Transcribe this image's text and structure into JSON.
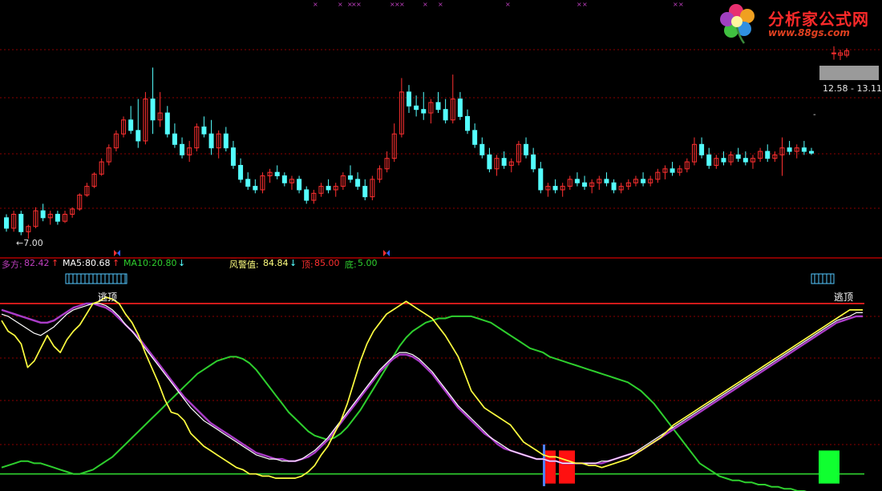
{
  "logo": {
    "title": "分析家公式网",
    "url": "www.88gs.com"
  },
  "price_panel": {
    "low_label": "←7.00",
    "range_label": "12.58 - 13.11"
  },
  "indicator_header": {
    "duofang_label": "多方:",
    "duofang_value": "82.42",
    "duofang_arrow": "↑",
    "ma5_label": "MA5:",
    "ma5_value": "80.68",
    "ma5_arrow": "↑",
    "ma10_label": "MA10:",
    "ma10_value": "20.80",
    "ma10_arrow": "↓",
    "warn_label": "风警值:",
    "warn_value": "84.84",
    "warn_arrow": "↓",
    "top_label": "顶:",
    "top_value": "85.00",
    "bottom_label": "底:",
    "bottom_value": "5.00"
  },
  "signals": {
    "escape_top_1": "逃顶",
    "escape_top_2": "逃顶"
  },
  "colors": {
    "up": "#ff3030",
    "down": "#54ffff",
    "grid": "#8b0000",
    "duofang": "#ffff40",
    "ma5": "#ffffff",
    "ma10": "#aa3cc8",
    "warn": "#2ecf2e",
    "top_line": "#ff2020",
    "bottom_line": "#2ecf2e",
    "marker": "#c040c0"
  },
  "chart_data": [
    {
      "type": "candlestick",
      "title": "",
      "xlabel": "",
      "ylabel": "",
      "candles": [
        [
          7.6,
          7.7,
          7.2,
          7.3
        ],
        [
          7.3,
          7.8,
          7.2,
          7.7
        ],
        [
          7.7,
          7.8,
          7.1,
          7.2
        ],
        [
          7.2,
          7.4,
          7.0,
          7.35
        ],
        [
          7.35,
          7.9,
          7.3,
          7.8
        ],
        [
          7.8,
          8.0,
          7.5,
          7.6
        ],
        [
          7.6,
          7.8,
          7.4,
          7.7
        ],
        [
          7.7,
          7.8,
          7.4,
          7.5
        ],
        [
          7.5,
          7.8,
          7.45,
          7.7
        ],
        [
          7.7,
          7.9,
          7.6,
          7.85
        ],
        [
          7.85,
          8.3,
          7.8,
          8.25
        ],
        [
          8.25,
          8.6,
          8.2,
          8.5
        ],
        [
          8.5,
          8.9,
          8.45,
          8.85
        ],
        [
          8.85,
          9.3,
          8.8,
          9.2
        ],
        [
          9.2,
          9.7,
          9.1,
          9.6
        ],
        [
          9.6,
          10.1,
          9.5,
          10.0
        ],
        [
          10.0,
          10.5,
          9.9,
          10.4
        ],
        [
          10.4,
          10.8,
          10.0,
          10.1
        ],
        [
          10.1,
          11.0,
          9.6,
          9.8
        ],
        [
          9.8,
          11.2,
          9.7,
          11.0
        ],
        [
          11.0,
          11.9,
          10.0,
          10.4
        ],
        [
          10.4,
          11.2,
          10.2,
          10.6
        ],
        [
          10.6,
          10.8,
          9.9,
          10.0
        ],
        [
          10.0,
          10.3,
          9.6,
          9.7
        ],
        [
          9.7,
          9.9,
          9.3,
          9.4
        ],
        [
          9.4,
          9.8,
          9.2,
          9.6
        ],
        [
          9.6,
          10.3,
          9.5,
          10.2
        ],
        [
          10.2,
          10.5,
          9.9,
          10.0
        ],
        [
          10.0,
          10.4,
          9.4,
          9.6
        ],
        [
          9.6,
          10.1,
          9.3,
          10.0
        ],
        [
          10.0,
          10.2,
          9.5,
          9.6
        ],
        [
          9.6,
          9.8,
          9.0,
          9.1
        ],
        [
          9.1,
          9.3,
          8.6,
          8.7
        ],
        [
          8.7,
          8.9,
          8.4,
          8.5
        ],
        [
          8.5,
          8.7,
          8.3,
          8.4
        ],
        [
          8.4,
          8.9,
          8.3,
          8.8
        ],
        [
          8.8,
          9.0,
          8.6,
          8.9
        ],
        [
          8.9,
          9.1,
          8.7,
          8.8
        ],
        [
          8.8,
          8.9,
          8.5,
          8.6
        ],
        [
          8.6,
          8.8,
          8.4,
          8.7
        ],
        [
          8.7,
          8.8,
          8.3,
          8.4
        ],
        [
          8.4,
          8.5,
          8.0,
          8.1
        ],
        [
          8.1,
          8.4,
          8.0,
          8.3
        ],
        [
          8.3,
          8.6,
          8.2,
          8.5
        ],
        [
          8.5,
          8.7,
          8.3,
          8.4
        ],
        [
          8.4,
          8.6,
          8.2,
          8.5
        ],
        [
          8.5,
          8.9,
          8.4,
          8.8
        ],
        [
          8.8,
          9.1,
          8.6,
          8.7
        ],
        [
          8.7,
          8.9,
          8.4,
          8.5
        ],
        [
          8.5,
          8.7,
          8.1,
          8.2
        ],
        [
          8.2,
          8.8,
          8.1,
          8.7
        ],
        [
          8.7,
          9.1,
          8.6,
          9.0
        ],
        [
          9.0,
          9.5,
          8.9,
          9.3
        ],
        [
          9.3,
          10.3,
          9.2,
          10.0
        ],
        [
          10.0,
          11.6,
          9.9,
          11.2
        ],
        [
          11.2,
          11.4,
          10.6,
          10.8
        ],
        [
          10.8,
          11.1,
          10.5,
          10.7
        ],
        [
          10.7,
          11.2,
          10.4,
          10.6
        ],
        [
          10.6,
          11.0,
          10.3,
          10.9
        ],
        [
          10.9,
          11.2,
          10.6,
          10.7
        ],
        [
          10.7,
          11.0,
          10.3,
          10.4
        ],
        [
          10.4,
          11.7,
          10.3,
          11.0
        ],
        [
          11.0,
          11.2,
          10.4,
          10.5
        ],
        [
          10.5,
          10.7,
          10.0,
          10.1
        ],
        [
          10.1,
          10.3,
          9.6,
          9.7
        ],
        [
          9.7,
          9.9,
          9.3,
          9.4
        ],
        [
          9.4,
          9.6,
          8.9,
          9.0
        ],
        [
          9.0,
          9.4,
          8.8,
          9.3
        ],
        [
          9.3,
          9.5,
          9.0,
          9.1
        ],
        [
          9.1,
          9.3,
          8.9,
          9.2
        ],
        [
          9.2,
          9.8,
          9.1,
          9.7
        ],
        [
          9.7,
          9.9,
          9.3,
          9.4
        ],
        [
          9.4,
          9.6,
          8.9,
          9.0
        ],
        [
          9.0,
          9.2,
          8.3,
          8.4
        ],
        [
          8.4,
          8.6,
          8.2,
          8.5
        ],
        [
          8.5,
          8.7,
          8.3,
          8.4
        ],
        [
          8.4,
          8.6,
          8.2,
          8.5
        ],
        [
          8.5,
          8.8,
          8.4,
          8.7
        ],
        [
          8.7,
          8.9,
          8.5,
          8.6
        ],
        [
          8.6,
          8.8,
          8.4,
          8.5
        ],
        [
          8.5,
          8.7,
          8.3,
          8.6
        ],
        [
          8.6,
          8.8,
          8.4,
          8.7
        ],
        [
          8.7,
          8.9,
          8.5,
          8.6
        ],
        [
          8.6,
          8.7,
          8.3,
          8.4
        ],
        [
          8.4,
          8.6,
          8.3,
          8.5
        ],
        [
          8.5,
          8.7,
          8.4,
          8.6
        ],
        [
          8.6,
          8.8,
          8.5,
          8.7
        ],
        [
          8.7,
          8.9,
          8.5,
          8.6
        ],
        [
          8.6,
          8.8,
          8.5,
          8.7
        ],
        [
          8.7,
          9.0,
          8.6,
          8.9
        ],
        [
          8.9,
          9.1,
          8.7,
          9.0
        ],
        [
          9.0,
          9.2,
          8.8,
          8.9
        ],
        [
          8.9,
          9.1,
          8.8,
          9.0
        ],
        [
          9.0,
          9.3,
          8.9,
          9.2
        ],
        [
          9.2,
          9.9,
          9.1,
          9.7
        ],
        [
          9.7,
          9.9,
          9.3,
          9.4
        ],
        [
          9.4,
          9.6,
          9.0,
          9.1
        ],
        [
          9.1,
          9.4,
          9.0,
          9.3
        ],
        [
          9.3,
          9.5,
          9.1,
          9.2
        ],
        [
          9.2,
          9.5,
          9.1,
          9.4
        ],
        [
          9.4,
          9.6,
          9.2,
          9.3
        ],
        [
          9.3,
          9.5,
          9.1,
          9.2
        ],
        [
          9.2,
          9.4,
          9.0,
          9.3
        ],
        [
          9.3,
          9.6,
          9.2,
          9.5
        ],
        [
          9.5,
          9.7,
          9.2,
          9.3
        ],
        [
          9.3,
          9.5,
          9.2,
          9.4
        ],
        [
          9.4,
          9.9,
          8.8,
          9.6
        ],
        [
          9.6,
          9.8,
          9.4,
          9.5
        ],
        [
          9.5,
          9.7,
          9.3,
          9.6
        ],
        [
          9.6,
          9.8,
          9.4,
          9.5
        ],
        [
          9.5,
          9.6,
          9.4,
          9.45
        ]
      ],
      "right_candles": [
        [
          12.9,
          13.2,
          12.6,
          12.9
        ],
        [
          12.9,
          13.05,
          12.58,
          12.8
        ],
        [
          12.8,
          13.11,
          12.7,
          13.0
        ]
      ]
    },
    {
      "type": "line",
      "title": "",
      "xlabel": "",
      "ylabel": "",
      "ylim": [
        0,
        100
      ],
      "top_level": 85,
      "bottom_level": 5,
      "series": [
        {
          "name": "多方",
          "values": [
            77,
            72,
            70,
            66,
            55,
            58,
            64,
            70,
            65,
            62,
            68,
            72,
            75,
            80,
            85,
            86,
            88,
            87,
            85,
            80,
            76,
            70,
            62,
            55,
            48,
            40,
            34,
            33,
            30,
            24,
            21,
            18,
            16,
            14,
            12,
            10,
            8,
            7,
            5,
            5,
            4,
            4,
            3,
            3,
            3,
            3,
            4,
            6,
            9,
            14,
            18,
            24,
            30,
            38,
            48,
            58,
            66,
            72,
            76,
            80,
            82,
            84,
            86,
            84,
            82,
            80,
            78,
            74,
            70,
            65,
            60,
            52,
            44,
            40,
            36,
            34,
            32,
            30,
            28,
            24,
            20,
            18,
            16,
            14,
            13,
            13,
            12,
            11,
            10,
            10,
            9,
            9,
            8,
            9,
            10,
            11,
            12,
            14,
            16,
            18,
            20,
            22,
            25,
            28,
            30,
            32,
            34,
            36,
            38,
            40,
            42,
            44,
            46,
            48,
            50,
            52,
            54,
            56,
            58,
            60,
            62,
            64,
            66,
            68,
            70,
            72,
            74,
            76,
            78,
            80,
            82,
            82,
            82
          ]
        },
        {
          "name": "MA5",
          "values": [
            80,
            79,
            77,
            75,
            73,
            71,
            70,
            72,
            74,
            77,
            80,
            82,
            83,
            84,
            85,
            85,
            84,
            82,
            79,
            75,
            72,
            68,
            64,
            60,
            56,
            52,
            48,
            44,
            40,
            36,
            33,
            30,
            28,
            26,
            24,
            22,
            20,
            18,
            16,
            14,
            13,
            12,
            12,
            11,
            11,
            11,
            12,
            14,
            16,
            19,
            22,
            26,
            30,
            34,
            38,
            42,
            46,
            50,
            54,
            57,
            60,
            62,
            62,
            61,
            59,
            56,
            53,
            49,
            45,
            41,
            37,
            34,
            31,
            28,
            25,
            22,
            20,
            18,
            16,
            15,
            14,
            13,
            12,
            12,
            11,
            11,
            10,
            10,
            10,
            10,
            10,
            10,
            11,
            11,
            12,
            13,
            14,
            15,
            17,
            19,
            21,
            23,
            25,
            27,
            29,
            31,
            33,
            35,
            37,
            39,
            41,
            43,
            45,
            47,
            49,
            51,
            53,
            55,
            57,
            59,
            61,
            63,
            65,
            67,
            69,
            71,
            73,
            75,
            77,
            78,
            79,
            80.68,
            80.68
          ]
        },
        {
          "name": "MA10",
          "values": [
            82,
            81,
            80,
            79,
            78,
            77,
            76,
            76,
            77,
            79,
            81,
            83,
            84,
            85,
            85,
            84,
            83,
            81,
            78,
            75,
            72,
            69,
            65,
            61,
            57,
            53,
            49,
            45,
            41,
            38,
            35,
            32,
            29,
            27,
            25,
            23,
            21,
            19,
            17,
            15,
            14,
            13,
            12,
            12,
            11,
            11,
            12,
            13,
            15,
            18,
            21,
            25,
            29,
            33,
            37,
            41,
            45,
            49,
            53,
            56,
            59,
            61,
            61,
            60,
            58,
            55,
            52,
            48,
            44,
            40,
            36,
            33,
            30,
            27,
            24,
            22,
            19,
            17,
            16,
            15,
            14,
            13,
            12,
            12,
            11,
            11,
            10,
            10,
            10,
            10,
            10,
            10,
            10,
            11,
            12,
            13,
            14,
            15,
            16,
            18,
            20,
            22,
            24,
            26,
            28,
            30,
            32,
            34,
            36,
            38,
            40,
            42,
            44,
            46,
            48,
            50,
            52,
            54,
            56,
            58,
            60,
            62,
            64,
            66,
            68,
            70,
            72,
            74,
            76,
            77,
            78,
            79,
            79
          ]
        },
        {
          "name": "风警值",
          "values": [
            8,
            9,
            10,
            11,
            11,
            10,
            10,
            9,
            8,
            7,
            6,
            5,
            5,
            6,
            7,
            9,
            11,
            13,
            16,
            19,
            22,
            25,
            28,
            31,
            34,
            37,
            40,
            43,
            46,
            49,
            52,
            54,
            56,
            58,
            59,
            60,
            60,
            59,
            57,
            54,
            50,
            46,
            42,
            38,
            34,
            31,
            28,
            25,
            23,
            22,
            21,
            22,
            24,
            27,
            31,
            35,
            40,
            45,
            50,
            55,
            60,
            65,
            69,
            72,
            74,
            76,
            77,
            78,
            78,
            79,
            79,
            79,
            79,
            78,
            77,
            76,
            74,
            72,
            70,
            68,
            66,
            64,
            63,
            62,
            60,
            59,
            58,
            57,
            56,
            55,
            54,
            53,
            52,
            51,
            50,
            49,
            48,
            46,
            44,
            41,
            38,
            34,
            30,
            26,
            22,
            18,
            14,
            10,
            8,
            6,
            4,
            3,
            2,
            2,
            1,
            1,
            0,
            0,
            -1,
            -1,
            -2,
            -2,
            -3,
            -3,
            -4,
            -4,
            -5,
            -5,
            -5,
            -6,
            -6,
            -6,
            -6
          ]
        }
      ],
      "signal_bars": [
        {
          "color": "red",
          "from": 5,
          "to": 16
        },
        {
          "color": "red",
          "from": 5,
          "to": 16
        },
        {
          "color": "green",
          "from": 5,
          "to": 16
        }
      ]
    }
  ]
}
